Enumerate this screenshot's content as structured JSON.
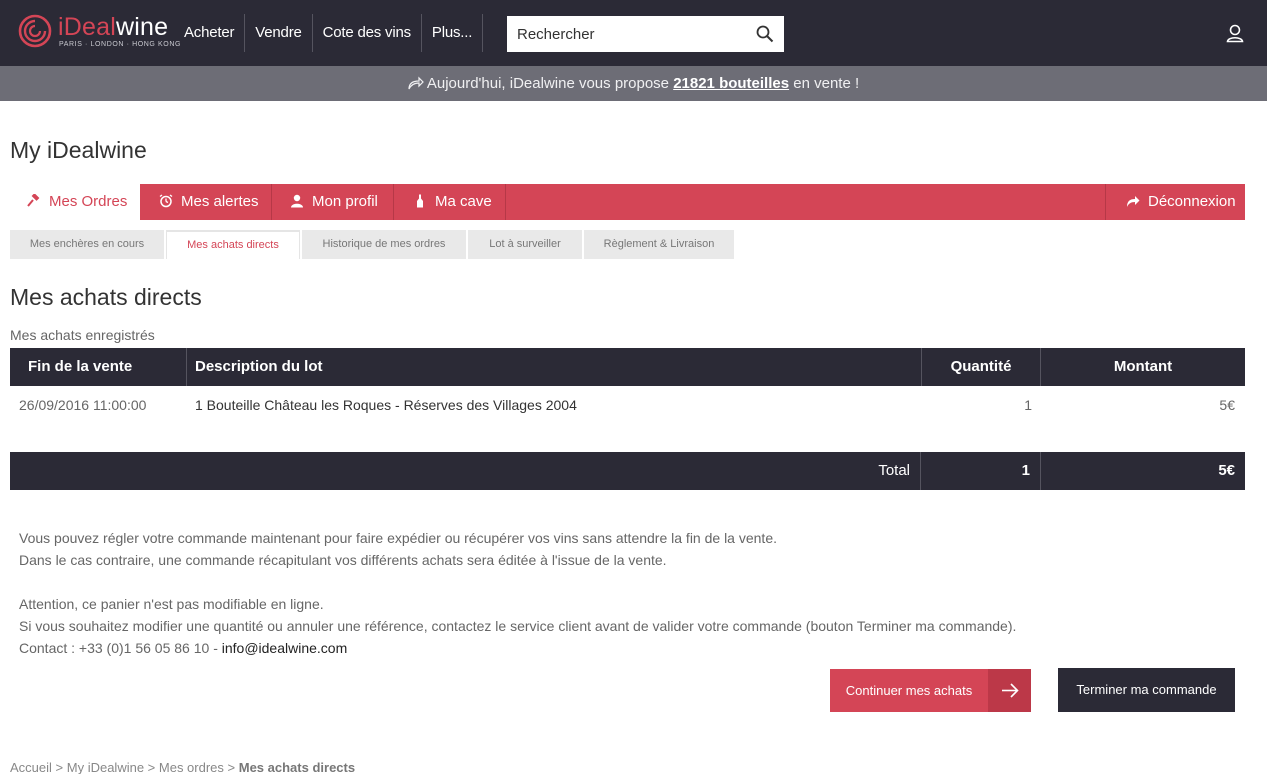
{
  "brand": {
    "name_i": "i",
    "name_dl": "Deal",
    "name_rest": "wine",
    "tagline": "PARIS · LONDON · HONG KONG",
    "accent": "#d44556",
    "dark": "#2b2a36"
  },
  "nav": {
    "links": [
      "Acheter",
      "Vendre",
      "Cote des vins",
      "Plus..."
    ],
    "search_placeholder": "Rechercher"
  },
  "promo": {
    "prefix": "Aujourd'hui, iDealwine vous propose ",
    "count": "21821 bouteilles",
    "suffix": " en vente !"
  },
  "page": {
    "title": "My iDealwine"
  },
  "tabs": {
    "orders": "Mes Ordres",
    "alerts": "Mes alertes",
    "profile": "Mon profil",
    "cellar": "Ma cave",
    "logout": "Déconnexion"
  },
  "subtabs": [
    "Mes enchères en cours",
    "Mes achats directs",
    "Historique de mes ordres",
    "Lot à surveiller",
    "Règlement & Livraison"
  ],
  "section": {
    "title": "Mes achats directs",
    "subtitle": "Mes achats enregistrés"
  },
  "table": {
    "headers": {
      "end": "Fin de la vente",
      "description": "Description du lot",
      "quantity": "Quantité",
      "amount": "Montant"
    },
    "rows": [
      {
        "end": "26/09/2016 11:00:00",
        "description": "1 Bouteille Château les Roques - Réserves des Villages 2004",
        "quantity": "1",
        "amount": "5€"
      }
    ],
    "total": {
      "label": "Total",
      "quantity": "1",
      "amount": "5€"
    }
  },
  "info": {
    "line1": "Vous pouvez régler votre commande maintenant pour faire expédier ou récupérer vos vins sans attendre la fin de la vente.",
    "line2": "Dans le cas contraire, une commande récapitulant vos différents achats sera éditée à l'issue de la vente.",
    "line3": "Attention, ce panier n'est pas modifiable en ligne.",
    "line4": "Si vous souhaitez modifier une quantité ou annuler une référence, contactez le service client avant de valider votre commande (bouton Terminer ma commande).",
    "contact_prefix": "Contact : +33 (0)1 56 05 86 10 - ",
    "email": "info@idealwine.com"
  },
  "buttons": {
    "continue": "Continuer mes achats",
    "finish": "Terminer ma commande"
  },
  "breadcrumb": {
    "items": [
      "Accueil",
      "My iDealwine",
      "Mes ordres"
    ],
    "separator": " > ",
    "current": "Mes achats directs"
  }
}
